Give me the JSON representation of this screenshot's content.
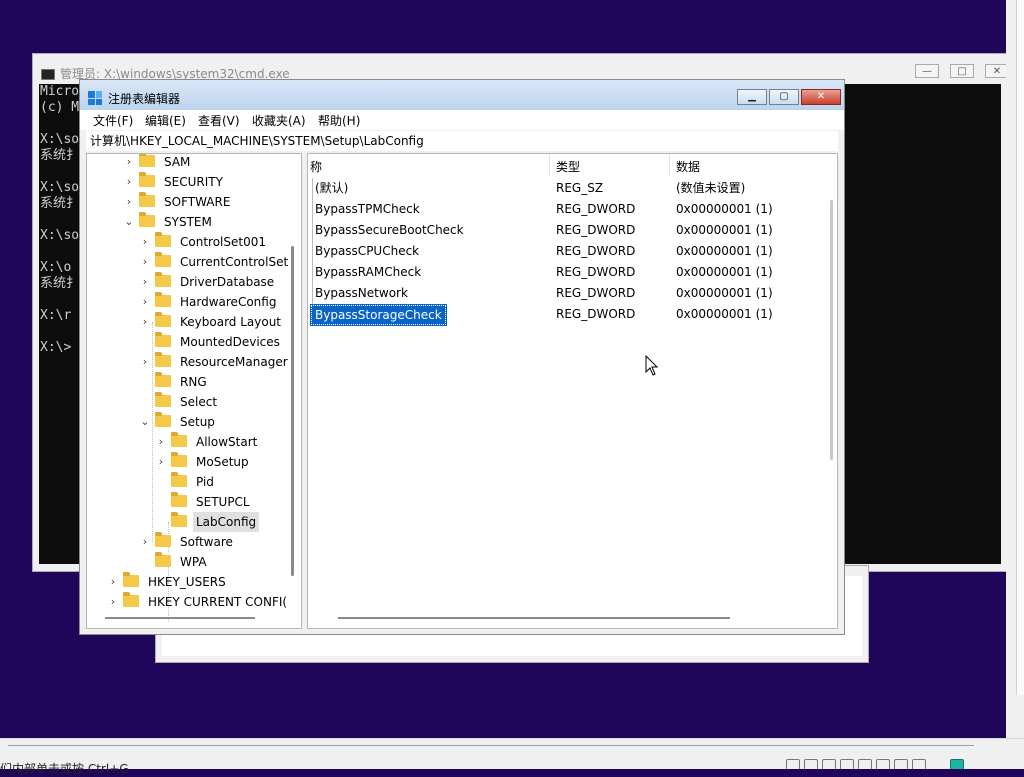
{
  "desktop": {
    "bg": "#20065a",
    "accent": "#0a64c8"
  },
  "status_hint": "们内部单击或按 Ctrl+G",
  "cmd": {
    "title": "管理员: X:\\windows\\system32\\cmd.exe",
    "lines": [
      "Micro",
      "(c) M",
      "",
      "X:\\so",
      "系统扌",
      "",
      "X:\\so",
      "系统扌",
      "",
      "X:\\so",
      "",
      "X:\\o",
      "系统扌",
      "",
      "X:\\r",
      "",
      "X:\\>"
    ]
  },
  "regedit": {
    "title": "注册表编辑器",
    "menu": [
      "文件(F)",
      "编辑(E)",
      "查看(V)",
      "收藏夹(A)",
      "帮助(H)"
    ],
    "address": "计算机\\HKEY_LOCAL_MACHINE\\SYSTEM\\Setup\\LabConfig",
    "tree": [
      {
        "label": "SAM",
        "chevron": "›"
      },
      {
        "label": "SECURITY",
        "chevron": "›"
      },
      {
        "label": "SOFTWARE",
        "chevron": "›"
      },
      {
        "label": "SYSTEM",
        "chevron": "⌄"
      },
      {
        "label": "ControlSet001",
        "chevron": "›"
      },
      {
        "label": "CurrentControlSet",
        "chevron": "›"
      },
      {
        "label": "DriverDatabase",
        "chevron": "›"
      },
      {
        "label": "HardwareConfig",
        "chevron": "›"
      },
      {
        "label": "Keyboard Layout",
        "chevron": "›"
      },
      {
        "label": "MountedDevices",
        "chevron": ""
      },
      {
        "label": "ResourceManager",
        "chevron": "›"
      },
      {
        "label": "RNG",
        "chevron": ""
      },
      {
        "label": "Select",
        "chevron": ""
      },
      {
        "label": "Setup",
        "chevron": "⌄"
      },
      {
        "label": "AllowStart",
        "chevron": "›"
      },
      {
        "label": "MoSetup",
        "chevron": "›"
      },
      {
        "label": "Pid",
        "chevron": ""
      },
      {
        "label": "SETUPCL",
        "chevron": ""
      },
      {
        "label": "LabConfig",
        "chevron": "",
        "selected": true
      },
      {
        "label": "Software",
        "chevron": "›"
      },
      {
        "label": "WPA",
        "chevron": ""
      },
      {
        "label": "HKEY_USERS",
        "chevron": "›"
      },
      {
        "label": "HKEY CURRENT CONFI(",
        "chevron": "›"
      }
    ],
    "columns": [
      "称",
      "类型",
      "数据"
    ],
    "values": [
      {
        "name": "(默认)",
        "type": "REG_SZ",
        "data": "(数值未设置)"
      },
      {
        "name": "BypassTPMCheck",
        "type": "REG_DWORD",
        "data": "0x00000001 (1)"
      },
      {
        "name": "BypassSecureBootCheck",
        "type": "REG_DWORD",
        "data": "0x00000001 (1)"
      },
      {
        "name": "BypassCPUCheck",
        "type": "REG_DWORD",
        "data": "0x00000001 (1)"
      },
      {
        "name": "BypassRAMCheck",
        "type": "REG_DWORD",
        "data": "0x00000001 (1)"
      },
      {
        "name": "BypassNetwork",
        "type": "REG_DWORD",
        "data": "0x00000001 (1)"
      },
      {
        "name": "BypassStorageCheck",
        "type": "REG_DWORD",
        "data": "0x00000001 (1)",
        "selected": true
      }
    ]
  }
}
